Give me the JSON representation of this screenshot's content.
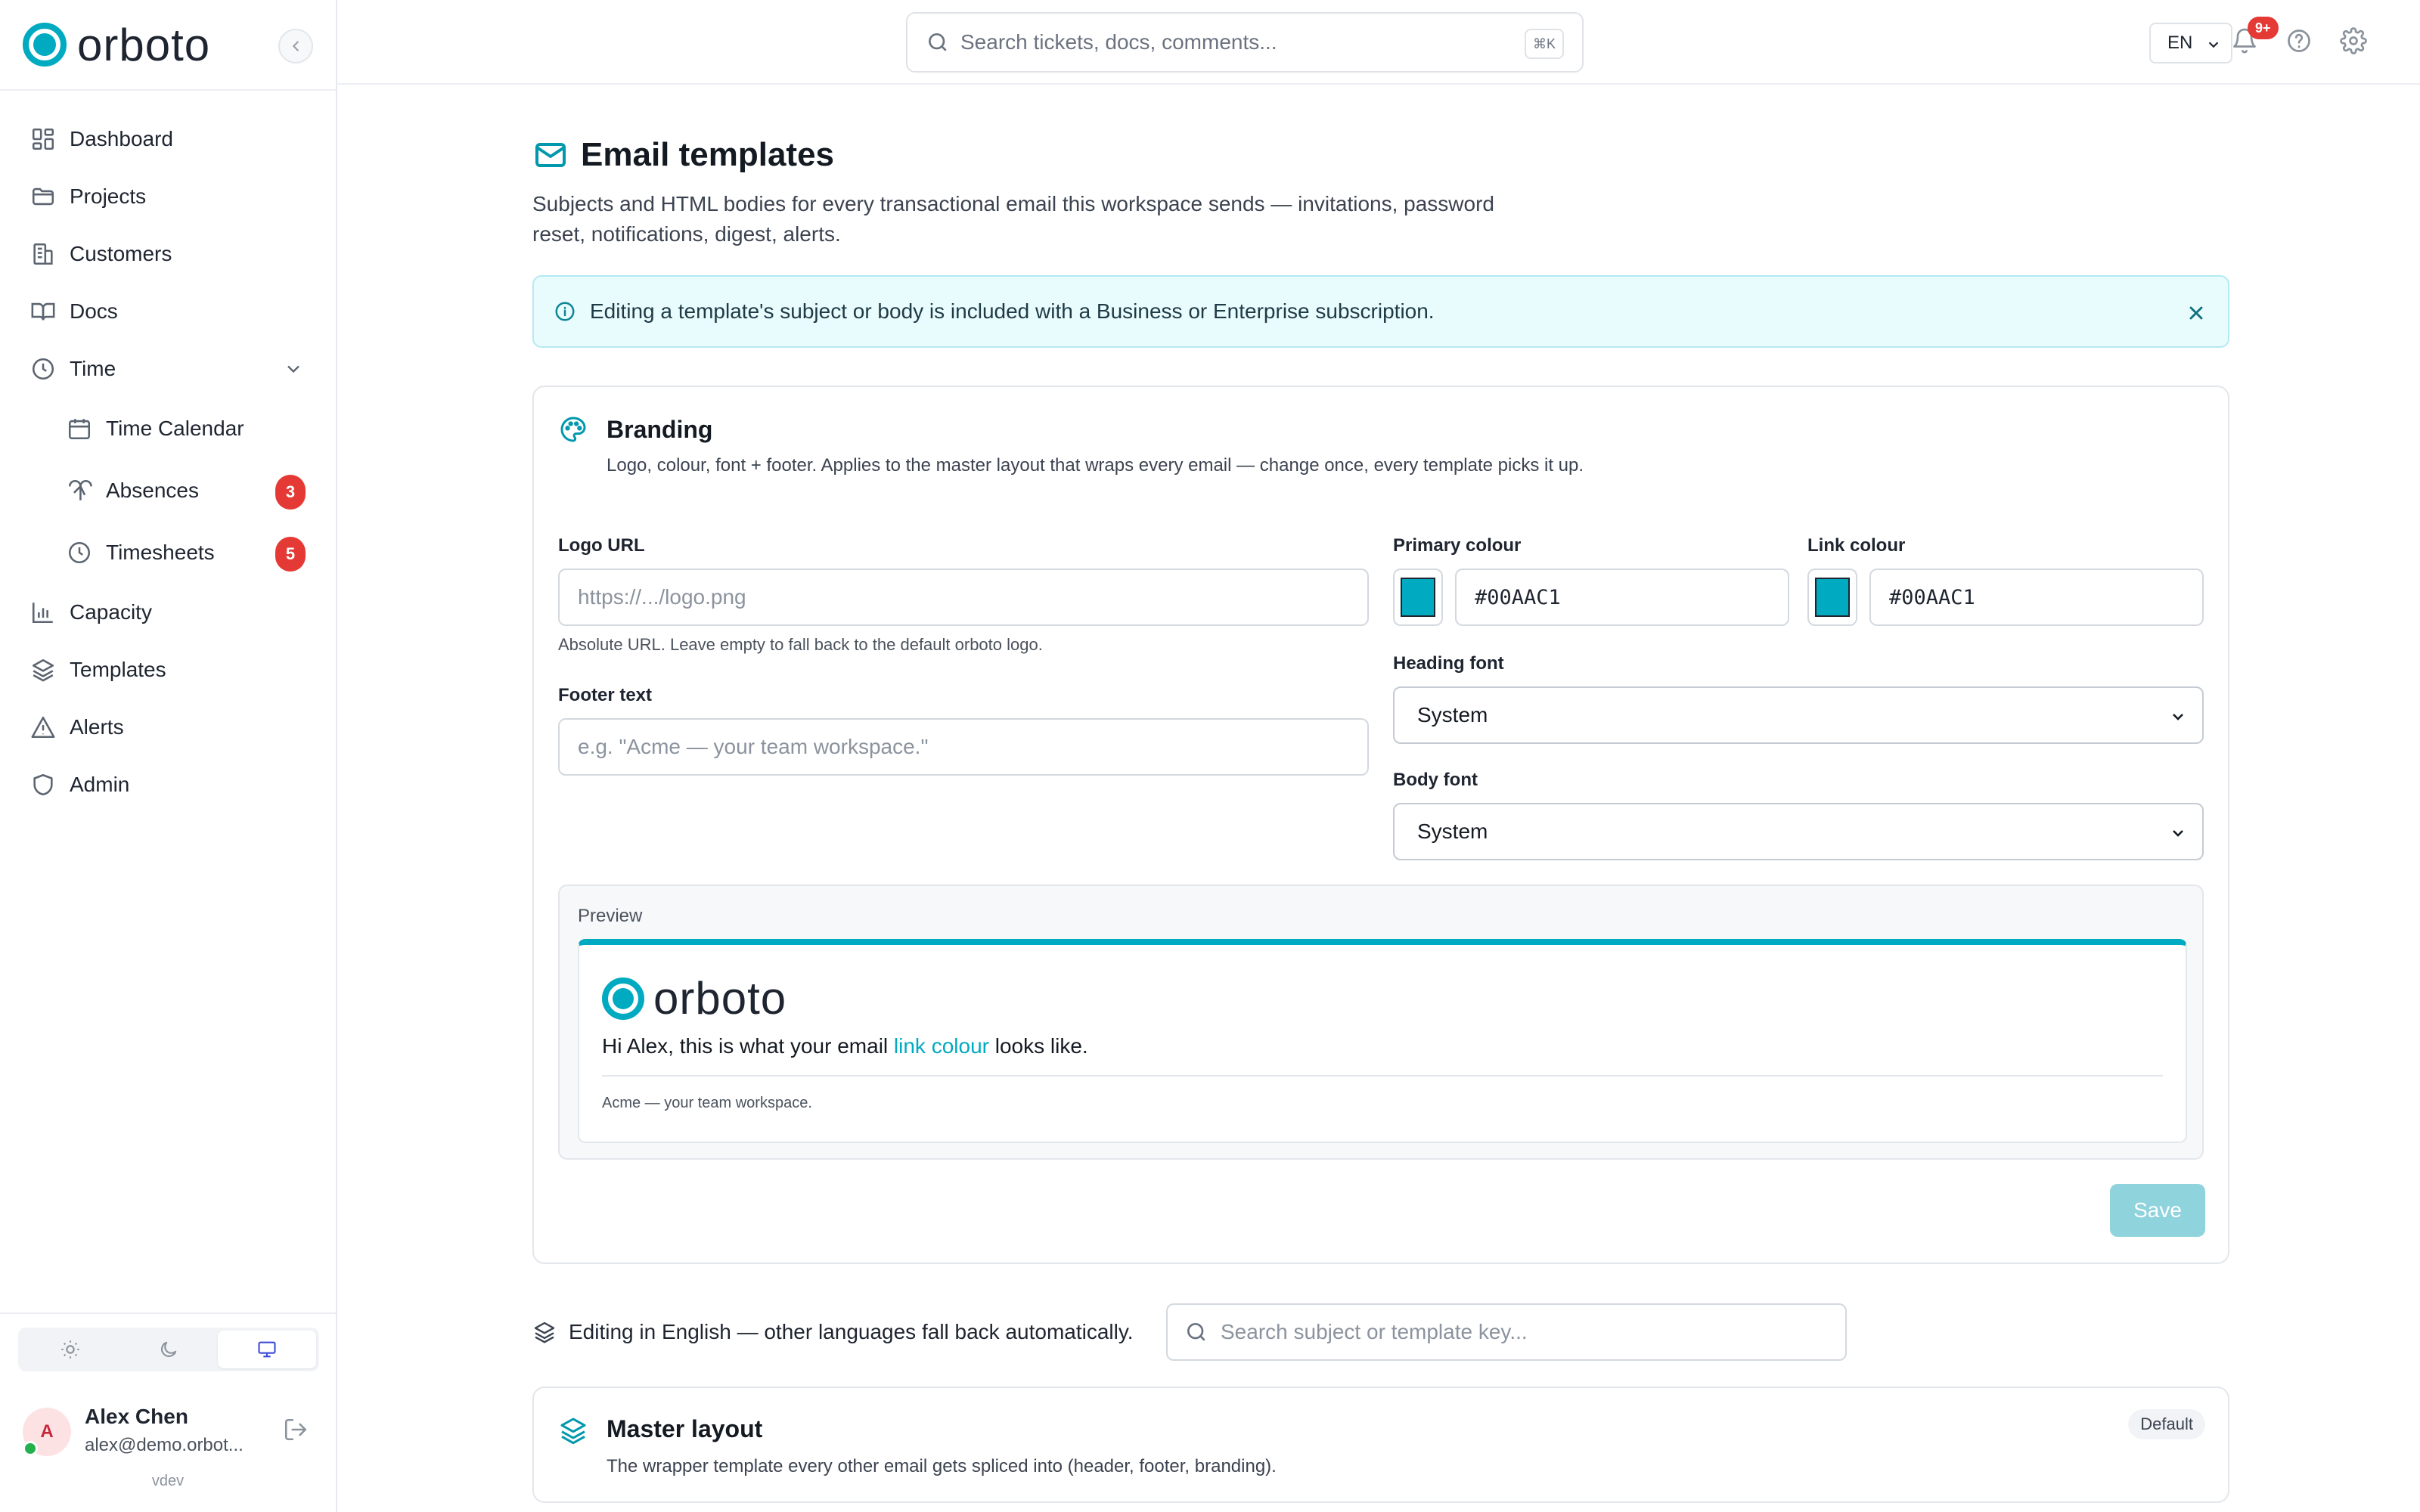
{
  "app": {
    "brand": "orboto",
    "env": "vdev"
  },
  "sidebar": {
    "items": [
      {
        "label": "Dashboard",
        "icon": "dashboard-icon"
      },
      {
        "label": "Projects",
        "icon": "folder-icon"
      },
      {
        "label": "Customers",
        "icon": "building-icon"
      },
      {
        "label": "Docs",
        "icon": "book-icon"
      },
      {
        "label": "Time",
        "icon": "clock-icon",
        "expanded": true
      },
      {
        "label": "Time Calendar",
        "icon": "calendar-icon"
      },
      {
        "label": "Absences",
        "icon": "palm-tree-icon",
        "badge": "3"
      },
      {
        "label": "Timesheets",
        "icon": "clock-icon",
        "badge": "5"
      },
      {
        "label": "Capacity",
        "icon": "bar-chart-icon"
      },
      {
        "label": "Templates",
        "icon": "layers-icon"
      },
      {
        "label": "Alerts",
        "icon": "warning-icon"
      },
      {
        "label": "Admin",
        "icon": "shield-icon"
      }
    ],
    "user": {
      "initial": "A",
      "name": "Alex Chen",
      "email": "alex@demo.orbot..."
    }
  },
  "topbar": {
    "search_placeholder": "Search tickets, docs, comments...",
    "search_shortcut": "⌘K",
    "language": "EN",
    "notifications_badge": "9+"
  },
  "page": {
    "title": "Email templates",
    "description": "Subjects and HTML bodies for every transactional email this workspace sends — invitations, password reset, notifications, digest, alerts.",
    "notice": "Editing a template's subject or body is included with a Business or Enterprise subscription."
  },
  "branding": {
    "title": "Branding",
    "subtitle": "Logo, colour, font + footer. Applies to the master layout that wraps every email — change once, every template picks it up.",
    "logo_url": {
      "label": "Logo URL",
      "placeholder": "https://.../logo.png",
      "hint": "Absolute URL. Leave empty to fall back to the default orboto logo."
    },
    "footer_text": {
      "label": "Footer text",
      "placeholder": "e.g. \"Acme — your team workspace.\""
    },
    "primary_colour": {
      "label": "Primary colour",
      "value": "#00AAC1"
    },
    "link_colour": {
      "label": "Link colour",
      "value": "#00AAC1"
    },
    "heading_font": {
      "label": "Heading font",
      "value": "System"
    },
    "body_font": {
      "label": "Body font",
      "value": "System"
    },
    "preview": {
      "label": "Preview",
      "greeting_before": "Hi Alex, this is what your email",
      "link_text": "link colour",
      "greeting_after": "looks like.",
      "footer": "Acme — your team workspace."
    },
    "save_label": "Save"
  },
  "editing": {
    "text": "Editing in English — other languages fall back automatically.",
    "search_placeholder": "Search subject or template key..."
  },
  "master_layout": {
    "title": "Master layout",
    "description": "The wrapper template every other email gets spliced into (header, footer, branding).",
    "badge": "Default"
  },
  "colors": {
    "accent": "#00AAC1",
    "badge_red": "#e53935"
  }
}
